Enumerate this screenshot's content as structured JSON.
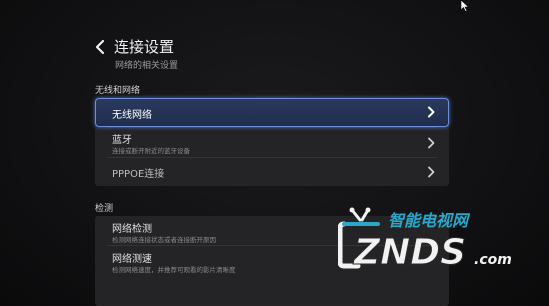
{
  "header": {
    "title": "连接设置",
    "subtitle": "网络的相关设置",
    "back_icon": "chevron-left-icon"
  },
  "sections": [
    {
      "label": "无线和网络",
      "items": [
        {
          "label": "无线网络",
          "description": "",
          "selected": true
        },
        {
          "label": "蓝牙",
          "description": "连接或断开附近的蓝牙设备",
          "selected": false
        },
        {
          "label": "PPPOE连接",
          "description": "",
          "selected": false
        }
      ]
    },
    {
      "label": "检测",
      "items": [
        {
          "label": "网络检测",
          "description": "检测网络连接状态或者连接断开原因",
          "selected": false
        },
        {
          "label": "网络测速",
          "description": "检测网络速度，并推荐可观看的影片清晰度",
          "selected": false
        }
      ]
    }
  ],
  "watermark": {
    "top_text": "智能电视网",
    "brand_text": "ZNDS",
    "suffix_text": ".com"
  },
  "colors": {
    "accent_border": "#6f8fd8",
    "selected_fill": "#2a3a5e",
    "watermark_white": "#f2f2f2",
    "watermark_teal": "#2aa7c9"
  }
}
